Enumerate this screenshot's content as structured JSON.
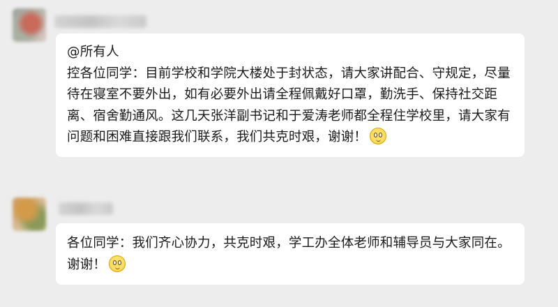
{
  "messages": [
    {
      "mention": "@所有人",
      "text": "控各位同学：目前学校和学院大楼处于封状态，请大家讲配合、守规定，尽量待在寝室不要外出，如有必要外出请全程佩戴好口罩，勤洗手、保持社交距离、宿舍勤通风。这几天张洋副书记和于爱涛老师都全程住学校里，请大家有问题和困难直接跟我们联系，我们共克时艰，谢谢！",
      "emoji": "smile-emoji-icon"
    },
    {
      "mention": "",
      "text": "各位同学：我们齐心协力，共克时艰，学工办全体老师和辅导员与大家同在。谢谢！",
      "emoji": "smile-emoji-icon"
    }
  ],
  "colors": {
    "background": "#ededed",
    "bubble": "#ffffff",
    "text": "#1a1a1a"
  }
}
